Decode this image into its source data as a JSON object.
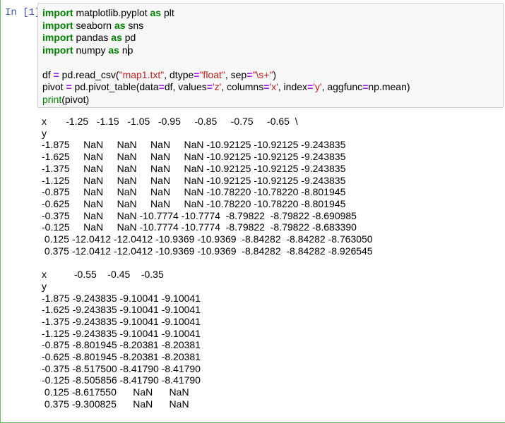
{
  "cell": {
    "prompt": "In [1]:",
    "code_lines": [
      [
        {
          "t": "import",
          "c": "kw"
        },
        {
          "t": " matplotlib.pyplot "
        },
        {
          "t": "as",
          "c": "kw"
        },
        {
          "t": " plt"
        }
      ],
      [
        {
          "t": "import",
          "c": "kw"
        },
        {
          "t": " seaborn "
        },
        {
          "t": "as",
          "c": "kw"
        },
        {
          "t": " sns"
        }
      ],
      [
        {
          "t": "import",
          "c": "kw"
        },
        {
          "t": " pandas "
        },
        {
          "t": "as",
          "c": "kw"
        },
        {
          "t": " pd"
        }
      ],
      [
        {
          "t": "import",
          "c": "kw"
        },
        {
          "t": " numpy "
        },
        {
          "t": "as",
          "c": "kw"
        },
        {
          "t": " n"
        },
        {
          "t": "",
          "c": "cursor"
        },
        {
          "t": "p"
        }
      ],
      [],
      [
        {
          "t": "df "
        },
        {
          "t": "=",
          "c": "op"
        },
        {
          "t": " pd.read_csv("
        },
        {
          "t": "\"map1.txt\"",
          "c": "str"
        },
        {
          "t": ", dtype"
        },
        {
          "t": "=",
          "c": "op"
        },
        {
          "t": "\"float\"",
          "c": "str"
        },
        {
          "t": ", sep"
        },
        {
          "t": "=",
          "c": "op"
        },
        {
          "t": "\"\\s+\"",
          "c": "str"
        },
        {
          "t": ")"
        }
      ],
      [
        {
          "t": "pivot "
        },
        {
          "t": "=",
          "c": "op"
        },
        {
          "t": " pd.pivot_table(data"
        },
        {
          "t": "=",
          "c": "op"
        },
        {
          "t": "df, values"
        },
        {
          "t": "=",
          "c": "op"
        },
        {
          "t": "'z'",
          "c": "str"
        },
        {
          "t": ", columns"
        },
        {
          "t": "=",
          "c": "op"
        },
        {
          "t": "'x'",
          "c": "str"
        },
        {
          "t": ", index"
        },
        {
          "t": "=",
          "c": "op"
        },
        {
          "t": "'y'",
          "c": "str"
        },
        {
          "t": ", aggfunc"
        },
        {
          "t": "=",
          "c": "op"
        },
        {
          "t": "np.mean)"
        }
      ],
      [
        {
          "t": "print",
          "c": "bi"
        },
        {
          "t": "(pivot)"
        }
      ]
    ],
    "output": "x       -1.25   -1.15   -1.05   -0.95     -0.85     -0.75     -0.65  \\\ny                                                                     \n-1.875     NaN     NaN     NaN     NaN -10.92125 -10.92125 -9.243835   \n-1.625     NaN     NaN     NaN     NaN -10.92125 -10.92125 -9.243835   \n-1.375     NaN     NaN     NaN     NaN -10.92125 -10.92125 -9.243835   \n-1.125     NaN     NaN     NaN     NaN -10.92125 -10.92125 -9.243835   \n-0.875     NaN     NaN     NaN     NaN -10.78220 -10.78220 -8.801945   \n-0.625     NaN     NaN     NaN     NaN -10.78220 -10.78220 -8.801945   \n-0.375     NaN     NaN -10.7774 -10.7774  -8.79822  -8.79822 -8.690985   \n-0.125     NaN     NaN -10.7774 -10.7774  -8.79822  -8.79822 -8.683390   \n 0.125 -12.0412 -12.0412 -10.9369 -10.9369  -8.84282  -8.84282 -8.763050   \n 0.375 -12.0412 -12.0412 -10.9369 -10.9369  -8.84282  -8.84282 -8.926545   \n\nx          -0.55    -0.45    -0.35  \ny                                   \n-1.875 -9.243835 -9.10041 -9.10041  \n-1.625 -9.243835 -9.10041 -9.10041  \n-1.375 -9.243835 -9.10041 -9.10041  \n-1.125 -9.243835 -9.10041 -9.10041  \n-0.875 -8.801945 -8.20381 -8.20381  \n-0.625 -8.801945 -8.20381 -8.20381  \n-0.375 -8.517500 -8.41790 -8.41790  \n-0.125 -8.505856 -8.41790 -8.41790  \n 0.125 -8.617550      NaN      NaN  \n 0.375 -9.300825      NaN      NaN  "
  },
  "colors": {
    "prompt": "#3f51b5",
    "keyword": "#008000",
    "string": "#ba2121",
    "operator": "#aa22ff",
    "cell_border": "#66bb6a",
    "input_background": "#f7f7f7"
  }
}
